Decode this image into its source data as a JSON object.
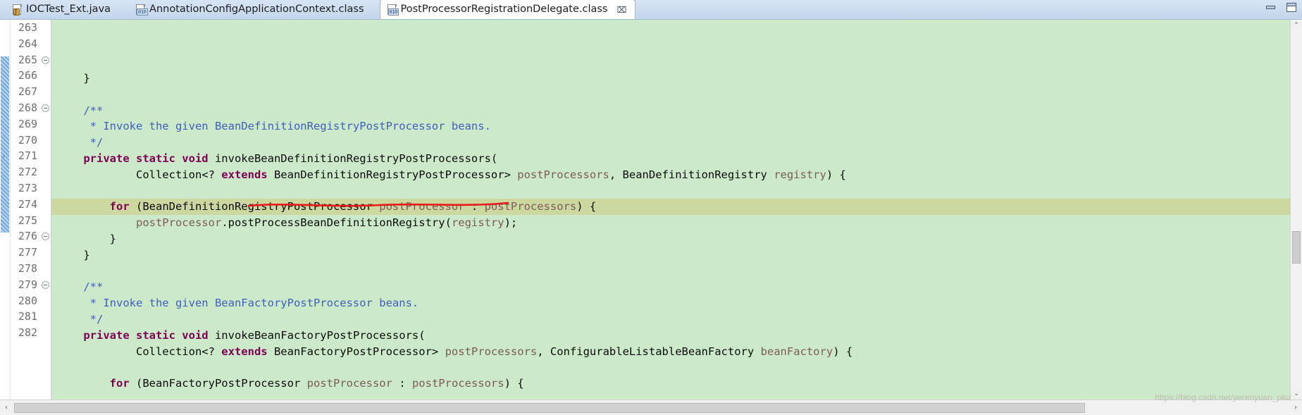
{
  "window": {
    "minimize_label": "–",
    "maximize_label": "□"
  },
  "tabs": [
    {
      "label": "IOCTest_Ext.java",
      "icon": "java-file-icon",
      "active": false,
      "badge": "J"
    },
    {
      "label": "AnnotationConfigApplicationContext.class",
      "icon": "class-file-icon",
      "active": false,
      "badge": "010"
    },
    {
      "label": "PostProcessorRegistrationDelegate.class",
      "icon": "class-file-icon",
      "active": true,
      "badge": "010",
      "close_label": "⌧"
    }
  ],
  "editor": {
    "first_line": 263,
    "lines": [
      {
        "n": 263,
        "fold": false,
        "hl": "none",
        "tokens": [
          {
            "t": "    }",
            "c": "pln"
          }
        ]
      },
      {
        "n": 264,
        "fold": false,
        "hl": "none",
        "tokens": [
          {
            "t": "",
            "c": "pln"
          }
        ]
      },
      {
        "n": 265,
        "fold": true,
        "hl": "none",
        "tokens": [
          {
            "t": "    /**",
            "c": "cmt"
          }
        ]
      },
      {
        "n": 266,
        "fold": false,
        "hl": "none",
        "tokens": [
          {
            "t": "     * Invoke the given BeanDefinitionRegistryPostProcessor beans.",
            "c": "cmt"
          }
        ]
      },
      {
        "n": 267,
        "fold": false,
        "hl": "none",
        "tokens": [
          {
            "t": "     */",
            "c": "cmt"
          }
        ]
      },
      {
        "n": 268,
        "fold": true,
        "hl": "none",
        "tokens": [
          {
            "t": "    ",
            "c": "pln"
          },
          {
            "t": "private static void",
            "c": "kw"
          },
          {
            "t": " invokeBeanDefinitionRegistryPostProcessors(",
            "c": "pln"
          }
        ]
      },
      {
        "n": 269,
        "fold": false,
        "hl": "none",
        "tokens": [
          {
            "t": "            Collection<? ",
            "c": "pln"
          },
          {
            "t": "extends",
            "c": "kw"
          },
          {
            "t": " BeanDefinitionRegistryPostProcessor> ",
            "c": "pln"
          },
          {
            "t": "postProcessors",
            "c": "fld"
          },
          {
            "t": ", BeanDefinitionRegistry ",
            "c": "pln"
          },
          {
            "t": "registry",
            "c": "fld"
          },
          {
            "t": ") {",
            "c": "pln"
          }
        ]
      },
      {
        "n": 270,
        "fold": false,
        "hl": "none",
        "tokens": [
          {
            "t": "",
            "c": "pln"
          }
        ]
      },
      {
        "n": 271,
        "fold": false,
        "hl": "selected",
        "tokens": [
          {
            "t": "        ",
            "c": "pln"
          },
          {
            "t": "for",
            "c": "kw"
          },
          {
            "t": " (BeanDefinitionRegistryPostProcessor ",
            "c": "pln"
          },
          {
            "t": "postProcessor",
            "c": "fld"
          },
          {
            "t": " : ",
            "c": "pln"
          },
          {
            "t": "postProcessors",
            "c": "fld"
          },
          {
            "t": ") {",
            "c": "pln"
          }
        ]
      },
      {
        "n": 272,
        "fold": false,
        "hl": "none",
        "tokens": [
          {
            "t": "            ",
            "c": "pln"
          },
          {
            "t": "postProcessor",
            "c": "fld"
          },
          {
            "t": ".postProcessBeanDefinitionRegistry(",
            "c": "pln"
          },
          {
            "t": "registry",
            "c": "fld"
          },
          {
            "t": ");",
            "c": "pln"
          }
        ]
      },
      {
        "n": 273,
        "fold": false,
        "hl": "none",
        "tokens": [
          {
            "t": "        }",
            "c": "pln"
          }
        ]
      },
      {
        "n": 274,
        "fold": false,
        "hl": "none",
        "tokens": [
          {
            "t": "    }",
            "c": "pln"
          }
        ]
      },
      {
        "n": 275,
        "fold": false,
        "hl": "none",
        "tokens": [
          {
            "t": "",
            "c": "pln"
          }
        ]
      },
      {
        "n": 276,
        "fold": true,
        "hl": "none",
        "tokens": [
          {
            "t": "    /**",
            "c": "cmt"
          }
        ]
      },
      {
        "n": 277,
        "fold": false,
        "hl": "none",
        "tokens": [
          {
            "t": "     * Invoke the given BeanFactoryPostProcessor beans.",
            "c": "cmt"
          }
        ]
      },
      {
        "n": 278,
        "fold": false,
        "hl": "none",
        "tokens": [
          {
            "t": "     */",
            "c": "cmt"
          }
        ]
      },
      {
        "n": 279,
        "fold": true,
        "hl": "none",
        "tokens": [
          {
            "t": "    ",
            "c": "pln"
          },
          {
            "t": "private static void",
            "c": "kw"
          },
          {
            "t": " invokeBeanFactoryPostProcessors(",
            "c": "pln"
          }
        ]
      },
      {
        "n": 280,
        "fold": false,
        "hl": "none",
        "tokens": [
          {
            "t": "            Collection<? ",
            "c": "pln"
          },
          {
            "t": "extends",
            "c": "kw"
          },
          {
            "t": " BeanFactoryPostProcessor> ",
            "c": "pln"
          },
          {
            "t": "postProcessors",
            "c": "fld"
          },
          {
            "t": ", ConfigurableListableBeanFactory ",
            "c": "pln"
          },
          {
            "t": "beanFactory",
            "c": "fld"
          },
          {
            "t": ") {",
            "c": "pln"
          }
        ]
      },
      {
        "n": 281,
        "fold": false,
        "hl": "none",
        "tokens": [
          {
            "t": "",
            "c": "pln"
          }
        ]
      },
      {
        "n": 282,
        "fold": false,
        "hl": "none",
        "tokens": [
          {
            "t": "        ",
            "c": "pln"
          },
          {
            "t": "for",
            "c": "kw"
          },
          {
            "t": " (BeanFactoryPostProcessor ",
            "c": "pln"
          },
          {
            "t": "postProcessor",
            "c": "fld"
          },
          {
            "t": " : ",
            "c": "pln"
          },
          {
            "t": "postProcessors",
            "c": "fld"
          },
          {
            "t": ") {",
            "c": "pln"
          }
        ]
      }
    ],
    "annotation_marker_line": 272,
    "background_color": "#cce9c9",
    "selected_line_color": "#cdd8a0",
    "keyword_color": "#7f0055",
    "comment_color": "#3f5fbf",
    "field_color": "#7c5c5c",
    "annotation_underline_color": "#e8191b",
    "annotation_underline_target": "postProcessBeanDefinitionRegistry"
  },
  "scrollbars": {
    "vertical_up": "⌃",
    "vertical_down": "⌄",
    "horizontal_left": "‹",
    "horizontal_right": "›"
  },
  "watermark": "https://blog.csdn.net/yerenyuan_pku"
}
